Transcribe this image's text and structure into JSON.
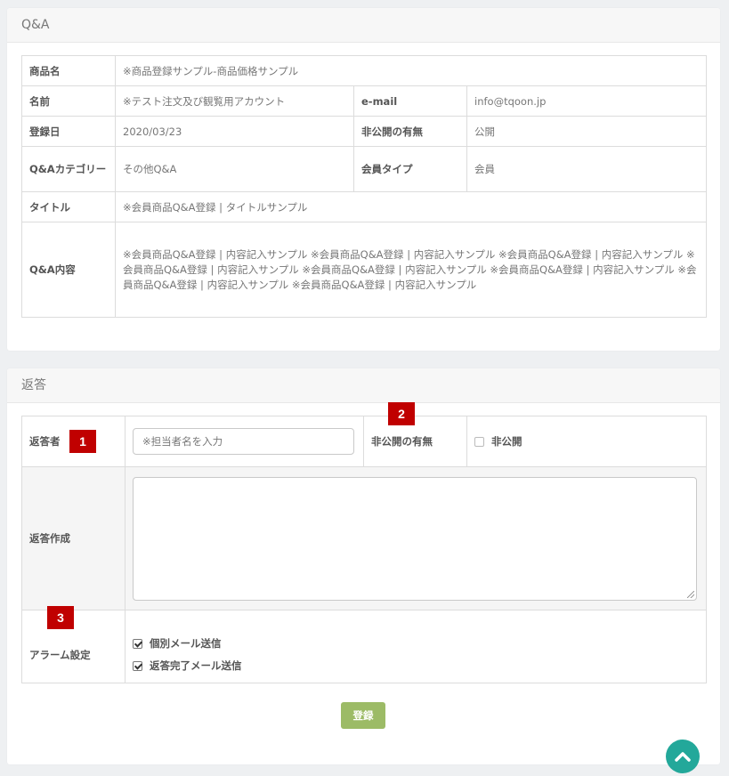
{
  "qa_panel": {
    "title": "Q&A",
    "rows": {
      "product_label": "商品名",
      "product_value": "※商品登録サンプル-商品価格サンプル",
      "name_label": "名前",
      "name_value": "※テスト注文及び観覧用アカウント",
      "email_label": "e-mail",
      "email_value": "info@tqoon.jp",
      "date_label": "登録日",
      "date_value": "2020/03/23",
      "private_label": "非公開の有無",
      "private_value": "公開",
      "category_label": "Q&Aカテゴリー",
      "category_value": "その他Q&A",
      "member_type_label": "会員タイプ",
      "member_type_value": "会員",
      "title_label": "タイトル",
      "title_value": "※会員商品Q&A登録 | タイトルサンプル",
      "content_label": "Q&A内容",
      "content_value": "※会員商品Q&A登録 | 内容記入サンプル ※会員商品Q&A登録 | 内容記入サンプル ※会員商品Q&A登録 | 内容記入サンプル ※会員商品Q&A登録 | 内容記入サンプル ※会員商品Q&A登録 | 内容記入サンプル ※会員商品Q&A登録 | 内容記入サンプル ※会員商品Q&A登録 | 内容記入サンプル ※会員商品Q&A登録 | 内容記入サンプル"
    }
  },
  "reply_panel": {
    "title": "返答",
    "responder_label": "返答者",
    "responder_placeholder": "※担当者名を入力",
    "private_label": "非公開の有無",
    "private_checkbox_label": "非公開",
    "private_checked": false,
    "compose_label": "返答作成",
    "compose_value": "",
    "alarm_label": "アラーム設定",
    "alarm_options": [
      {
        "label": "個別メール送信",
        "checked": true
      },
      {
        "label": "返答完了メール送信",
        "checked": true
      }
    ],
    "submit_label": "登録"
  },
  "markers": [
    "1",
    "2",
    "3"
  ],
  "colors": {
    "marker": "#c00000",
    "submit": "#9cbb66",
    "totop": "#23a89a"
  },
  "icons": {
    "totop": "chevron-up-icon"
  }
}
